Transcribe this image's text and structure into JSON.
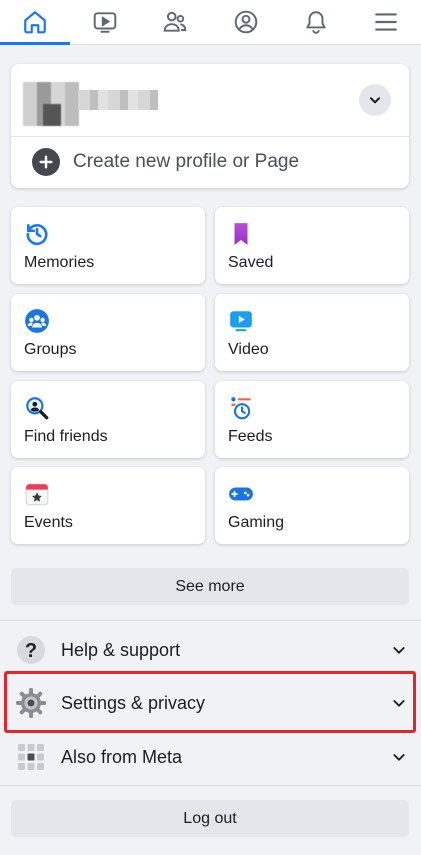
{
  "nav": {
    "items": [
      {
        "icon": "home-icon",
        "active": true
      },
      {
        "icon": "video-icon",
        "active": false
      },
      {
        "icon": "friends-icon",
        "active": false
      },
      {
        "icon": "profile-icon",
        "active": false
      },
      {
        "icon": "bell-icon",
        "active": false
      },
      {
        "icon": "menu-icon",
        "active": false
      }
    ],
    "accent": "#1877f2"
  },
  "profile": {
    "create_label": "Create new profile or Page"
  },
  "shortcuts": [
    {
      "label": "Memories",
      "icon": "memories-clock-icon"
    },
    {
      "label": "Saved",
      "icon": "saved-bookmark-icon"
    },
    {
      "label": "Groups",
      "icon": "groups-icon"
    },
    {
      "label": "Video",
      "icon": "video-play-icon"
    },
    {
      "label": "Find friends",
      "icon": "find-friends-icon"
    },
    {
      "label": "Feeds",
      "icon": "feeds-icon"
    },
    {
      "label": "Events",
      "icon": "calendar-star-icon"
    },
    {
      "label": "Gaming",
      "icon": "gamepad-icon"
    }
  ],
  "see_more_label": "See more",
  "menu": [
    {
      "label": "Help & support",
      "icon": "help-icon"
    },
    {
      "label": "Settings & privacy",
      "icon": "settings-gear-icon",
      "highlighted": true
    },
    {
      "label": "Also from Meta",
      "icon": "meta-grid-icon"
    }
  ],
  "logout_label": "Log out",
  "colors": {
    "highlight": "#e0282a",
    "background": "#f0f2f5"
  }
}
